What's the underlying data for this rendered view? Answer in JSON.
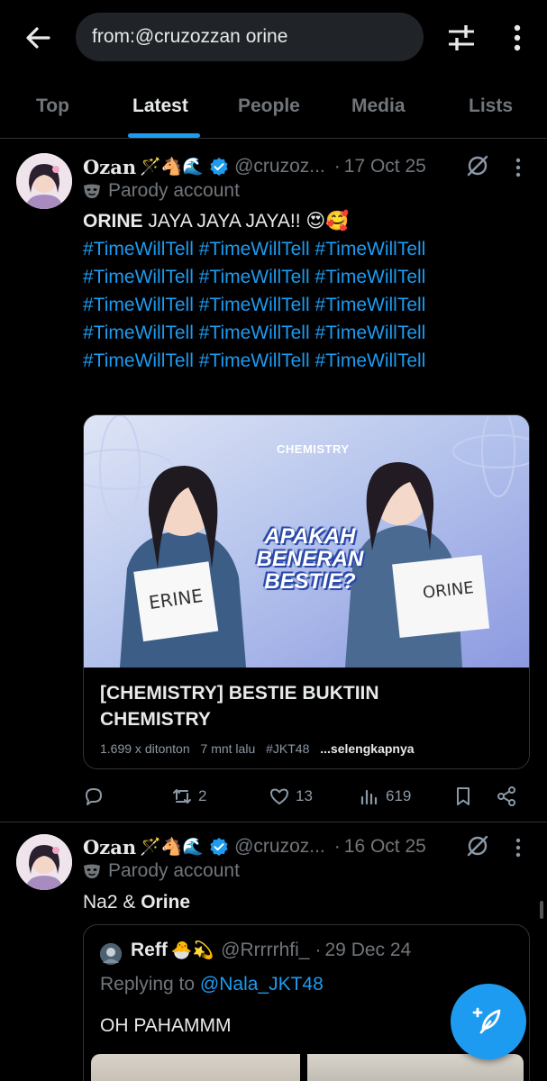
{
  "search": {
    "query": "from:@cruzozzan orine"
  },
  "tabs": [
    {
      "label": "Top"
    },
    {
      "label": "Latest"
    },
    {
      "label": "People"
    },
    {
      "label": "Media"
    },
    {
      "label": "Lists"
    }
  ],
  "active_tab": "Latest",
  "tweets": [
    {
      "name": "Ozan",
      "name_emoji": "🪄🐴🌊",
      "handle": "@cruzoz...",
      "separator": "·",
      "date": "17 Oct 25",
      "parody_label": "Parody account",
      "text_bold": "ORINE",
      "text_rest": " JAYA JAYA JAYA!! 😍🥰",
      "hashtag_lines": [
        "#TimeWillTell #TimeWillTell #TimeWillTell",
        "#TimeWillTell #TimeWillTell #TimeWillTell",
        "#TimeWillTell #TimeWillTell #TimeWillTell",
        "#TimeWillTell #TimeWillTell #TimeWillTell",
        "#TimeWillTell #TimeWillTell #TimeWillTell"
      ],
      "card": {
        "brand": "CHEMISTRY",
        "overlay_line1": "APAKAH",
        "overlay_line2": "BENERAN",
        "overlay_line3": "BESTIE?",
        "sign_left": "ERINE",
        "sign_right": "ORINE",
        "title_line1": "[CHEMISTRY] BESTIE BUKTIIN",
        "title_line2": "CHEMISTRY",
        "views": "1.699 x ditonton",
        "time": "7 mnt lalu",
        "tag": "#JKT48",
        "more": "...selengkapnya"
      },
      "actions": {
        "replies": "",
        "reposts": "2",
        "likes": "13",
        "views": "619"
      }
    },
    {
      "name": "Ozan",
      "name_emoji": "🪄🐴🌊",
      "handle": "@cruzoz...",
      "separator": "·",
      "date": "16 Oct 25",
      "parody_label": "Parody account",
      "text_plain": "Na2 & ",
      "text_bold": "Orine",
      "quote": {
        "name": "Reff",
        "name_emoji": "🐣💫",
        "handle": "@Rrrrrhfi_",
        "separator": "·",
        "date": "29 Dec 24",
        "replying_prefix": "Replying to ",
        "replying_handle": "@Nala_JKT48",
        "text": "OH PAHAMMM"
      }
    }
  ],
  "colors": {
    "accent": "#1d9bf0",
    "background": "#000000",
    "muted": "#71767b",
    "text": "#e7e9ea",
    "border": "#2f3336"
  }
}
